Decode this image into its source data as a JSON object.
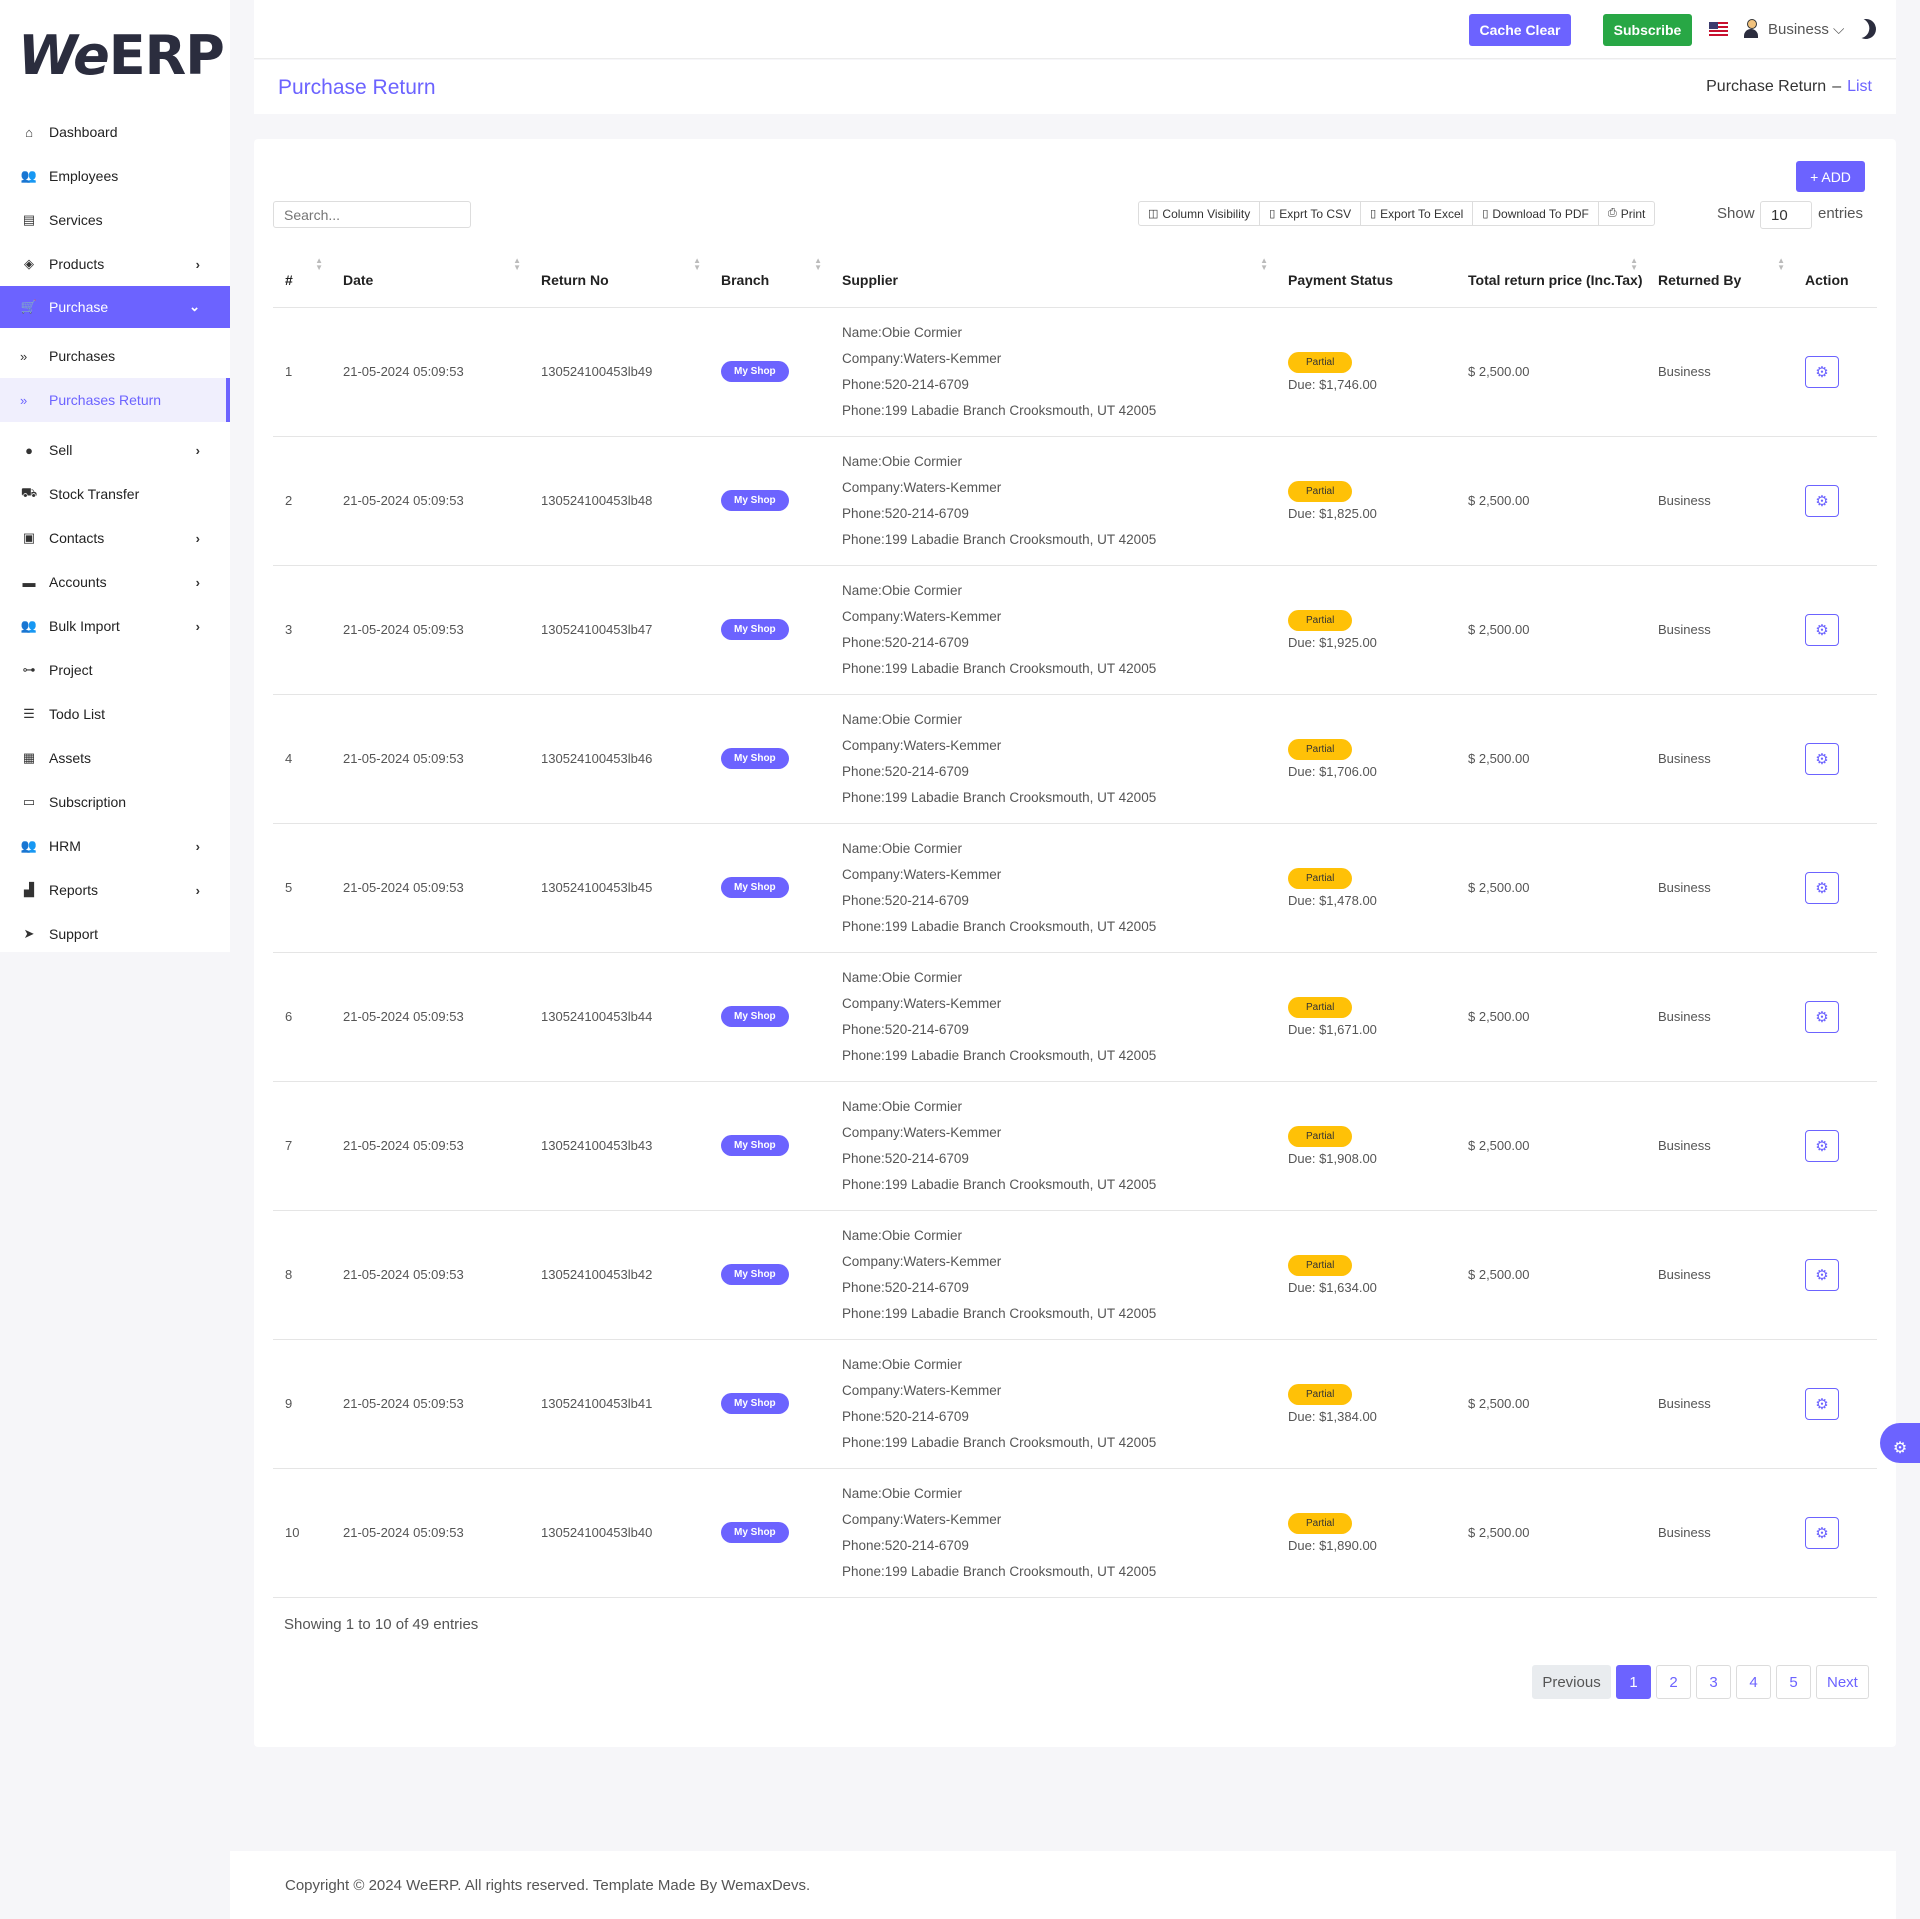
{
  "brand": {
    "logo_prefix": "We",
    "logo_suffix": "ERP"
  },
  "sidebar": {
    "items": [
      {
        "label": "Dashboard",
        "icon": "home-icon",
        "glyph": "⌂",
        "chevron": false
      },
      {
        "label": "Employees",
        "icon": "users-icon",
        "glyph": "👥",
        "chevron": false
      },
      {
        "label": "Services",
        "icon": "briefcase-icon",
        "glyph": "▤",
        "chevron": false
      },
      {
        "label": "Products",
        "icon": "box-icon",
        "glyph": "◈",
        "chevron": true
      },
      {
        "label": "Purchase",
        "icon": "cart-icon",
        "glyph": "🛒",
        "chevron": true,
        "active": true
      },
      {
        "label": "Sell",
        "icon": "circle-icon",
        "glyph": "●",
        "chevron": true
      },
      {
        "label": "Stock Transfer",
        "icon": "truck-icon",
        "glyph": "⛟",
        "chevron": false
      },
      {
        "label": "Contacts",
        "icon": "contacts-icon",
        "glyph": "▣",
        "chevron": true
      },
      {
        "label": "Accounts",
        "icon": "card-icon",
        "glyph": "▬",
        "chevron": true
      },
      {
        "label": "Bulk Import",
        "icon": "users-icon",
        "glyph": "👥",
        "chevron": true
      },
      {
        "label": "Project",
        "icon": "sitemap-icon",
        "glyph": "⊶",
        "chevron": false
      },
      {
        "label": "Todo List",
        "icon": "list-icon",
        "glyph": "☰",
        "chevron": false
      },
      {
        "label": "Assets",
        "icon": "assets-icon",
        "glyph": "▦",
        "chevron": false
      },
      {
        "label": "Subscription",
        "icon": "money-icon",
        "glyph": "▭",
        "chevron": false
      },
      {
        "label": "HRM",
        "icon": "users-icon",
        "glyph": "👥",
        "chevron": true
      },
      {
        "label": "Reports",
        "icon": "chart-icon",
        "glyph": "▟",
        "chevron": true
      },
      {
        "label": "Support",
        "icon": "send-icon",
        "glyph": "➤",
        "chevron": false
      }
    ],
    "purchase_sub": [
      {
        "label": "Purchases"
      },
      {
        "label": "Purchases Return",
        "current": true
      }
    ]
  },
  "header": {
    "cache_clear": "Cache Clear",
    "subscribe": "Subscribe",
    "user": "Business"
  },
  "page": {
    "title": "Purchase Return",
    "breadcrumb_parent": "Purchase Return",
    "breadcrumb_sep": "–",
    "breadcrumb_current": "List"
  },
  "toolbar": {
    "add": "+ ADD",
    "search_placeholder": "Search...",
    "tools": [
      {
        "label": "Column Visibility",
        "icon": "columns-icon",
        "glyph": "◫"
      },
      {
        "label": "Exprt To CSV",
        "icon": "file-icon",
        "glyph": "▯"
      },
      {
        "label": "Export To Excel",
        "icon": "excel-icon",
        "glyph": "▯"
      },
      {
        "label": "Download To PDF",
        "icon": "pdf-icon",
        "glyph": "▯"
      },
      {
        "label": "Print",
        "icon": "print-icon",
        "glyph": "⎙"
      }
    ],
    "show_label": "Show",
    "show_value": "10",
    "entries_label": "entries"
  },
  "table": {
    "headers": [
      "#",
      "Date",
      "Return No",
      "Branch",
      "Supplier",
      "Payment Status",
      "Total return price (Inc.Tax)",
      "Returned By",
      "Action"
    ],
    "rows": [
      {
        "n": "1",
        "date": "21-05-2024 05:09:53",
        "ret": "130524100453lb49",
        "branch": "My Shop",
        "name": "Name:Obie Cormier",
        "company": "Company:Waters-Kemmer",
        "phone": "Phone:520-214-6709",
        "addr": "Phone:199 Labadie Branch Crooksmouth, UT 42005",
        "status": "Partial",
        "due": "Due: $1,746.00",
        "total": "$ 2,500.00",
        "by": "Business"
      },
      {
        "n": "2",
        "date": "21-05-2024 05:09:53",
        "ret": "130524100453lb48",
        "branch": "My Shop",
        "name": "Name:Obie Cormier",
        "company": "Company:Waters-Kemmer",
        "phone": "Phone:520-214-6709",
        "addr": "Phone:199 Labadie Branch Crooksmouth, UT 42005",
        "status": "Partial",
        "due": "Due: $1,825.00",
        "total": "$ 2,500.00",
        "by": "Business"
      },
      {
        "n": "3",
        "date": "21-05-2024 05:09:53",
        "ret": "130524100453lb47",
        "branch": "My Shop",
        "name": "Name:Obie Cormier",
        "company": "Company:Waters-Kemmer",
        "phone": "Phone:520-214-6709",
        "addr": "Phone:199 Labadie Branch Crooksmouth, UT 42005",
        "status": "Partial",
        "due": "Due: $1,925.00",
        "total": "$ 2,500.00",
        "by": "Business"
      },
      {
        "n": "4",
        "date": "21-05-2024 05:09:53",
        "ret": "130524100453lb46",
        "branch": "My Shop",
        "name": "Name:Obie Cormier",
        "company": "Company:Waters-Kemmer",
        "phone": "Phone:520-214-6709",
        "addr": "Phone:199 Labadie Branch Crooksmouth, UT 42005",
        "status": "Partial",
        "due": "Due: $1,706.00",
        "total": "$ 2,500.00",
        "by": "Business"
      },
      {
        "n": "5",
        "date": "21-05-2024 05:09:53",
        "ret": "130524100453lb45",
        "branch": "My Shop",
        "name": "Name:Obie Cormier",
        "company": "Company:Waters-Kemmer",
        "phone": "Phone:520-214-6709",
        "addr": "Phone:199 Labadie Branch Crooksmouth, UT 42005",
        "status": "Partial",
        "due": "Due: $1,478.00",
        "total": "$ 2,500.00",
        "by": "Business"
      },
      {
        "n": "6",
        "date": "21-05-2024 05:09:53",
        "ret": "130524100453lb44",
        "branch": "My Shop",
        "name": "Name:Obie Cormier",
        "company": "Company:Waters-Kemmer",
        "phone": "Phone:520-214-6709",
        "addr": "Phone:199 Labadie Branch Crooksmouth, UT 42005",
        "status": "Partial",
        "due": "Due: $1,671.00",
        "total": "$ 2,500.00",
        "by": "Business"
      },
      {
        "n": "7",
        "date": "21-05-2024 05:09:53",
        "ret": "130524100453lb43",
        "branch": "My Shop",
        "name": "Name:Obie Cormier",
        "company": "Company:Waters-Kemmer",
        "phone": "Phone:520-214-6709",
        "addr": "Phone:199 Labadie Branch Crooksmouth, UT 42005",
        "status": "Partial",
        "due": "Due: $1,908.00",
        "total": "$ 2,500.00",
        "by": "Business"
      },
      {
        "n": "8",
        "date": "21-05-2024 05:09:53",
        "ret": "130524100453lb42",
        "branch": "My Shop",
        "name": "Name:Obie Cormier",
        "company": "Company:Waters-Kemmer",
        "phone": "Phone:520-214-6709",
        "addr": "Phone:199 Labadie Branch Crooksmouth, UT 42005",
        "status": "Partial",
        "due": "Due: $1,634.00",
        "total": "$ 2,500.00",
        "by": "Business"
      },
      {
        "n": "9",
        "date": "21-05-2024 05:09:53",
        "ret": "130524100453lb41",
        "branch": "My Shop",
        "name": "Name:Obie Cormier",
        "company": "Company:Waters-Kemmer",
        "phone": "Phone:520-214-6709",
        "addr": "Phone:199 Labadie Branch Crooksmouth, UT 42005",
        "status": "Partial",
        "due": "Due: $1,384.00",
        "total": "$ 2,500.00",
        "by": "Business"
      },
      {
        "n": "10",
        "date": "21-05-2024 05:09:53",
        "ret": "130524100453lb40",
        "branch": "My Shop",
        "name": "Name:Obie Cormier",
        "company": "Company:Waters-Kemmer",
        "phone": "Phone:520-214-6709",
        "addr": "Phone:199 Labadie Branch Crooksmouth, UT 42005",
        "status": "Partial",
        "due": "Due: $1,890.00",
        "total": "$ 2,500.00",
        "by": "Business"
      }
    ]
  },
  "pagination": {
    "info": "Showing 1 to 10 of 49 entries",
    "previous": "Previous",
    "pages": [
      "1",
      "2",
      "3",
      "4",
      "5"
    ],
    "active_page": "1",
    "next": "Next"
  },
  "footer": {
    "text": "Copyright © 2024 WeERP. All rights reserved. Template Made By WemaxDevs."
  },
  "colors": {
    "accent": "#6c63ff",
    "success": "#28a745",
    "warning": "#ffc107"
  }
}
